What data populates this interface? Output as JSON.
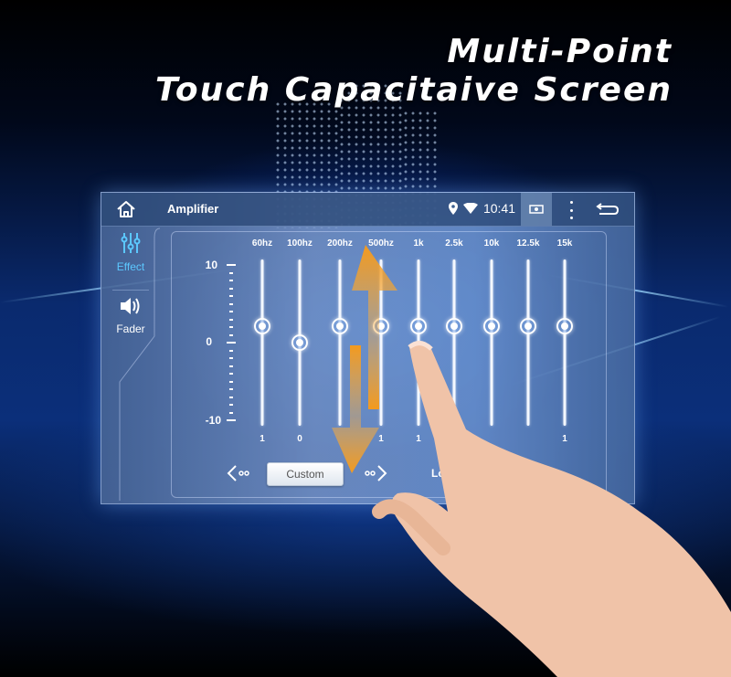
{
  "headline": {
    "line1": "Multi-Point",
    "line2": "Touch Capacitaive Screen"
  },
  "topbar": {
    "home_icon": "home-icon",
    "title": "Amplifier",
    "location_icon": "location-pin-icon",
    "wifi_icon": "wifi-icon",
    "time": "10:41",
    "screenshot_icon": "screenshot-icon",
    "menu_icon": "more-vert-icon",
    "back_icon": "back-icon"
  },
  "sidebar": {
    "items": [
      {
        "label": "Effect",
        "icon": "equalizer-icon",
        "active": true
      },
      {
        "label": "Fader",
        "icon": "speaker-icon",
        "active": false
      }
    ]
  },
  "equalizer": {
    "scale": {
      "max": "10",
      "mid": "0",
      "min": "-10"
    },
    "range": [
      -10,
      10
    ],
    "bands": [
      {
        "label": "60hz",
        "value": 1,
        "value_label": "1"
      },
      {
        "label": "100hz",
        "value": 0,
        "value_label": "0"
      },
      {
        "label": "200hz",
        "value": 1,
        "value_label": ""
      },
      {
        "label": "500hz",
        "value": 1,
        "value_label": "1"
      },
      {
        "label": "1k",
        "value": 1,
        "value_label": "1"
      },
      {
        "label": "2.5k",
        "value": 1,
        "value_label": ""
      },
      {
        "label": "10k",
        "value": 1,
        "value_label": ""
      },
      {
        "label": "12.5k",
        "value": 1,
        "value_label": ""
      },
      {
        "label": "15k",
        "value": 1,
        "value_label": "1"
      }
    ],
    "preset": "Custom",
    "loudness_label": "Lou"
  },
  "colors": {
    "accent": "#5cc8ff",
    "arrow": "#f39a1e"
  }
}
